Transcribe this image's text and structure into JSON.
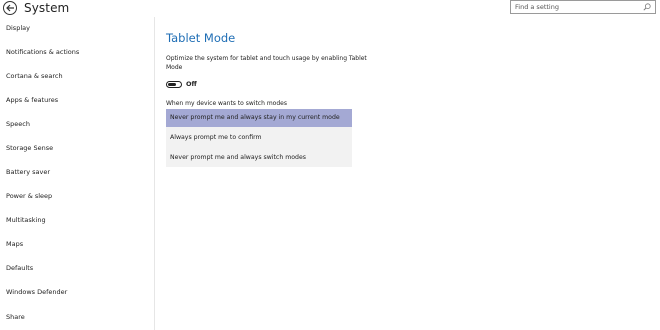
{
  "header": {
    "title": "System",
    "search": {
      "placeholder": "Find a setting",
      "value": ""
    }
  },
  "sidebar": {
    "items": [
      {
        "label": "Display"
      },
      {
        "label": "Notifications & actions"
      },
      {
        "label": "Cortana & search"
      },
      {
        "label": "Apps & features"
      },
      {
        "label": "Speech"
      },
      {
        "label": "Storage Sense"
      },
      {
        "label": "Battery saver"
      },
      {
        "label": "Power & sleep"
      },
      {
        "label": "Multitasking"
      },
      {
        "label": "Maps"
      },
      {
        "label": "Defaults"
      },
      {
        "label": "Windows Defender"
      },
      {
        "label": "Share"
      }
    ]
  },
  "main": {
    "title": "Tablet Mode",
    "description": "Optimize the system for tablet and touch usage by enabling Tablet Mode",
    "toggle": {
      "state": "Off",
      "on": false
    },
    "dropdown": {
      "label": "When my device wants to switch modes",
      "selected_index": 0,
      "options": [
        "Never prompt me and always stay in my current mode",
        "Always prompt me to confirm",
        "Never prompt me and always switch modes"
      ]
    }
  },
  "colors": {
    "accent": "#1f6eb5",
    "selected_option": "#a4a9d4",
    "dropdown_bg": "#f2f2f2"
  },
  "icons": {
    "back": "back-arrow-icon",
    "search": "search-icon"
  }
}
